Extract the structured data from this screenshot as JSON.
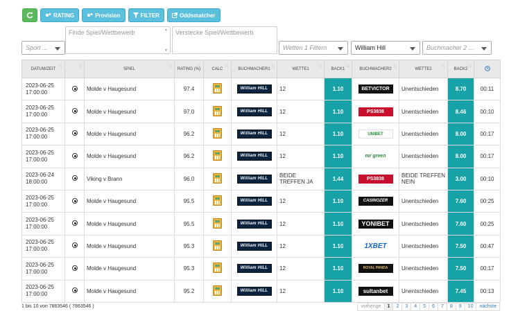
{
  "toolbar": {
    "refresh_icon": "refresh-icon",
    "rating_label": "RATING",
    "provision_label": "Provision",
    "filter_label": "FILTER",
    "oddsmatcher_label": "Oddsmatcher"
  },
  "filters": {
    "sport_placeholder": "Sport ...",
    "find_placeholder": "Finde Spiel/Wettbewerb",
    "hide_placeholder": "Verstecke Spiel/Wettbewerb",
    "bets_placeholder": "Wetten 1 Filtern",
    "bookmaker1_value": "William Hill",
    "bookmaker2_placeholder": "Buchmacher 2 ..."
  },
  "table": {
    "headers": [
      "DATUM/ZEIT",
      "",
      "SPIEL",
      "RATING (%)",
      "CALC",
      "BUCHMACHER1",
      "WETTE1",
      "BACK1",
      "BUCHMACHER2",
      "WETTE2",
      "BACK2",
      ""
    ],
    "rows": [
      {
        "date": "2023-06-25",
        "time": "17:00:00",
        "game": "Molde v Haugesund",
        "rating": "97.4",
        "bm1": "William HILL",
        "bet1": "12",
        "back1": "1.10",
        "bm2": "BETVICTOR",
        "bm2_style": "bk-dark",
        "bet2": "Unentschieden",
        "back2": "8.70",
        "age": "00:11"
      },
      {
        "date": "2023-06-25",
        "time": "17:00:00",
        "game": "Molde v Haugesund",
        "rating": "97.0",
        "bm1": "William HILL",
        "bet1": "12",
        "back1": "1.10",
        "bm2": "PS3838",
        "bm2_style": "bk-ps",
        "bet2": "Unentschieden",
        "back2": "8.46",
        "age": "00:10"
      },
      {
        "date": "2023-06-25",
        "time": "17:00:00",
        "game": "Molde v Haugesund",
        "rating": "96.2",
        "bm1": "William HILL",
        "bet1": "12",
        "back1": "1.10",
        "bm2": "UNIBET",
        "bm2_style": "bk-uni",
        "bet2": "Unentschieden",
        "back2": "8.00",
        "age": "00:17"
      },
      {
        "date": "2023-06-25",
        "time": "17:00:00",
        "game": "Molde v Haugesund",
        "rating": "96.2",
        "bm1": "William HILL",
        "bet1": "12",
        "back1": "1.10",
        "bm2": "mr green",
        "bm2_style": "bk-green",
        "bet2": "Unentschieden",
        "back2": "8.00",
        "age": "00:17"
      },
      {
        "date": "2023-06-24",
        "time": "18:00:00",
        "game": "Viking v Brann",
        "rating": "96.0",
        "bm1": "William HILL",
        "bet1": "BEIDE TREFFEN JA",
        "back1": "1.44",
        "bm2": "PS3838",
        "bm2_style": "bk-ps",
        "bet2": "BEIDE TREFFEN NEIN",
        "back2": "3.00",
        "age": "00:10"
      },
      {
        "date": "2023-06-25",
        "time": "17:00:00",
        "game": "Molde v Haugesund",
        "rating": "95.5",
        "bm1": "William HILL",
        "bet1": "12",
        "back1": "1.10",
        "bm2": "CASINOZER",
        "bm2_style": "bk-casino",
        "bet2": "Unentschieden",
        "back2": "7.60",
        "age": "00:25"
      },
      {
        "date": "2023-06-25",
        "time": "17:00:00",
        "game": "Molde v Haugesund",
        "rating": "95.5",
        "bm1": "William HILL",
        "bet1": "12",
        "back1": "1.10",
        "bm2": "YONIBET",
        "bm2_style": "bk-yoni",
        "bet2": "Unentschieden",
        "back2": "7.60",
        "age": "00:25"
      },
      {
        "date": "2023-06-25",
        "time": "17:00:00",
        "game": "Molde v Haugesund",
        "rating": "95.3",
        "bm1": "William HILL",
        "bet1": "12",
        "back1": "1.10",
        "bm2": "1XBET",
        "bm2_style": "bk-1x",
        "bet2": "Unentschieden",
        "back2": "7.50",
        "age": "00:47"
      },
      {
        "date": "2023-06-25",
        "time": "17:00:00",
        "game": "Molde v Haugesund",
        "rating": "95.3",
        "bm1": "William HILL",
        "bet1": "12",
        "back1": "1.10",
        "bm2": "ROYAL PANDA",
        "bm2_style": "bk-royal",
        "bet2": "Unentschieden",
        "back2": "7.50",
        "age": "00:17"
      },
      {
        "date": "2023-06-25",
        "time": "17:00:00",
        "game": "Molde v Haugesund",
        "rating": "95.2",
        "bm1": "William HILL",
        "bet1": "12",
        "back1": "1.10",
        "bm2": "sultanbet",
        "bm2_style": "bk-sultan",
        "bet2": "Unentschieden",
        "back2": "7.45",
        "age": "00:13"
      }
    ]
  },
  "footer": {
    "info": "1 bis 10 von 7863546 ( 7863546 )",
    "prev": "vorherige",
    "pages": [
      "1",
      "2",
      "3",
      "4",
      "5",
      "6",
      "7",
      "8",
      "9",
      "10"
    ],
    "next": "nächste"
  },
  "colors": {
    "accent": "#5bc0de",
    "back_highlight": "#17a2a7",
    "refresh_button": "#5cb85c"
  }
}
